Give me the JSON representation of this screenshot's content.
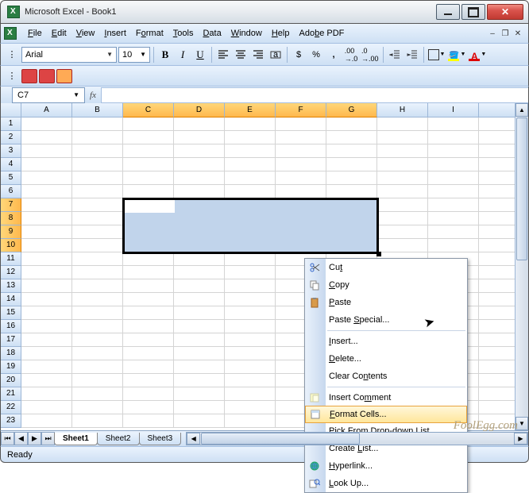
{
  "window": {
    "title": "Microsoft Excel - Book1"
  },
  "menu": {
    "items": [
      "File",
      "Edit",
      "View",
      "Insert",
      "Format",
      "Tools",
      "Data",
      "Window",
      "Help",
      "Adobe PDF"
    ]
  },
  "toolbar": {
    "font": "Arial",
    "size": "10",
    "buttons": {
      "bold": "B",
      "italic": "I",
      "underline": "U",
      "currency": "$",
      "percent": "%",
      "comma": ",",
      "font_color_letter": "A"
    }
  },
  "namebox": {
    "ref": "C7"
  },
  "columns": [
    "A",
    "B",
    "C",
    "D",
    "E",
    "F",
    "G",
    "H",
    "I"
  ],
  "rows": [
    "1",
    "2",
    "3",
    "4",
    "5",
    "6",
    "7",
    "8",
    "9",
    "10",
    "11",
    "12",
    "13",
    "14",
    "15",
    "16",
    "17",
    "18",
    "19",
    "20",
    "21",
    "22",
    "23"
  ],
  "selected_cols": [
    "C",
    "D",
    "E",
    "F",
    "G"
  ],
  "selected_rows": [
    "7",
    "8",
    "9",
    "10"
  ],
  "selection": {
    "active": "C7",
    "range": "C7:G10"
  },
  "context_menu": {
    "items": [
      {
        "label": "Cut",
        "icon": "scissors"
      },
      {
        "label": "Copy",
        "icon": "copy"
      },
      {
        "label": "Paste",
        "icon": "clipboard"
      },
      {
        "label": "Paste Special..."
      },
      {
        "sep": true
      },
      {
        "label": "Insert..."
      },
      {
        "label": "Delete..."
      },
      {
        "label": "Clear Contents"
      },
      {
        "sep": true
      },
      {
        "label": "Insert Comment",
        "icon": "comment"
      },
      {
        "label": "Format Cells...",
        "icon": "format",
        "highlight": true
      },
      {
        "label": "Pick From Drop-down List..."
      },
      {
        "label": "Create List..."
      },
      {
        "label": "Hyperlink...",
        "icon": "globe"
      },
      {
        "label": "Look Up...",
        "icon": "lookup"
      }
    ]
  },
  "sheets": {
    "tabs": [
      "Sheet1",
      "Sheet2",
      "Sheet3"
    ],
    "active": "Sheet1"
  },
  "status": {
    "text": "Ready"
  },
  "watermark": "FoolEgg.com"
}
